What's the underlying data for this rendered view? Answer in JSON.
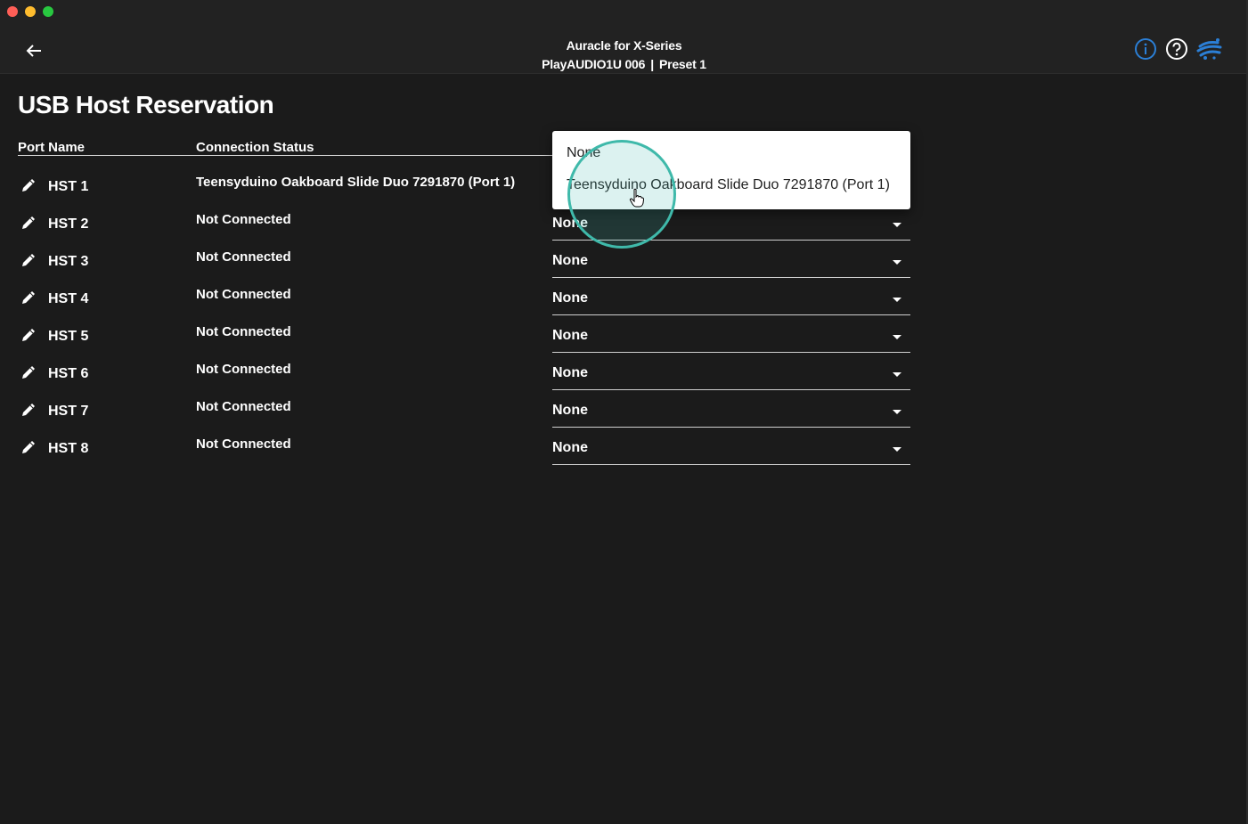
{
  "window": {
    "title": "Auracle for X-Series",
    "device": "PlayAUDIO1U 006",
    "separator": "|",
    "preset": "Preset 1"
  },
  "icons": {
    "back": "arrow-left-icon",
    "info": "info-icon",
    "help": "help-icon",
    "brand": "splash-logo-icon",
    "edit": "pencil-icon",
    "caret": "caret-down-icon"
  },
  "colors": {
    "background": "#1b1b1b",
    "titlebar": "#222222",
    "accent_blue": "#2b7fd6",
    "click_ring": "#3fb9aa",
    "dropdown_bg": "#ffffff"
  },
  "page": {
    "title": "USB Host Reservation",
    "columns": {
      "port_name": "Port Name",
      "connection_status": "Connection Status"
    }
  },
  "rows": [
    {
      "port": "HST 1",
      "status": "Teensyduino Oakboard Slide Duo 7291870 (Port 1)",
      "selection": ""
    },
    {
      "port": "HST 2",
      "status": "Not Connected",
      "selection": "None"
    },
    {
      "port": "HST 3",
      "status": "Not Connected",
      "selection": "None"
    },
    {
      "port": "HST 4",
      "status": "Not Connected",
      "selection": "None"
    },
    {
      "port": "HST 5",
      "status": "Not Connected",
      "selection": "None"
    },
    {
      "port": "HST 6",
      "status": "Not Connected",
      "selection": "None"
    },
    {
      "port": "HST 7",
      "status": "Not Connected",
      "selection": "None"
    },
    {
      "port": "HST 8",
      "status": "Not Connected",
      "selection": "None"
    }
  ],
  "dropdown": {
    "options": [
      "None",
      "Teensyduino Oakboard Slide Duo 7291870 (Port 1)"
    ]
  }
}
